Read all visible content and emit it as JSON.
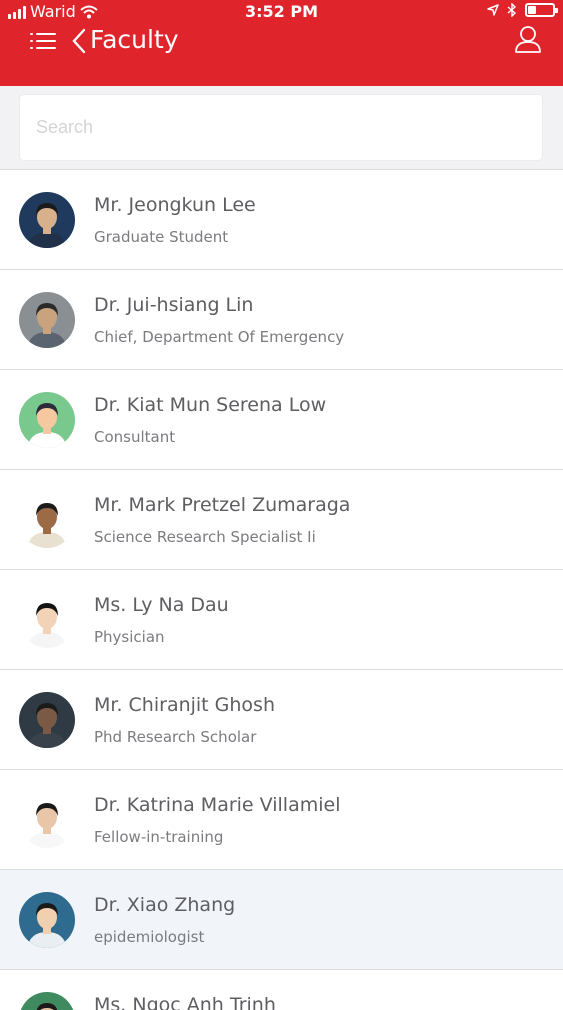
{
  "status_bar": {
    "carrier": "Warid",
    "time": "3:52 PM",
    "battery_level": 0.35
  },
  "nav": {
    "title": "Faculty",
    "menu_icon": "hamburger-menu-icon",
    "back_icon": "chevron-left-icon",
    "profile_icon": "user-profile-icon"
  },
  "search": {
    "placeholder": "Search",
    "value": ""
  },
  "colors": {
    "header": "#e0242c",
    "background": "#f2f2f4",
    "name_text": "#5e5e62",
    "title_text": "#7b7b80"
  },
  "faculty": [
    {
      "name": "Mr. Jeongkun Lee",
      "title": "Graduate Student"
    },
    {
      "name": "Dr. Jui-hsiang Lin",
      "title": "Chief, Department Of Emergency"
    },
    {
      "name": "Dr. Kiat Mun Serena Low",
      "title": "Consultant"
    },
    {
      "name": "Mr. Mark Pretzel Zumaraga",
      "title": "Science Research Specialist Ii"
    },
    {
      "name": "Ms. Ly Na Dau",
      "title": "Physician"
    },
    {
      "name": "Mr. Chiranjit Ghosh",
      "title": "Phd Research Scholar"
    },
    {
      "name": "Dr. Katrina Marie Villamiel",
      "title": "Fellow-in-training"
    },
    {
      "name": "Dr. Xiao Zhang",
      "title": "epidemiologist"
    },
    {
      "name": "Ms. Ngoc Anh Trinh",
      "title": ""
    }
  ]
}
